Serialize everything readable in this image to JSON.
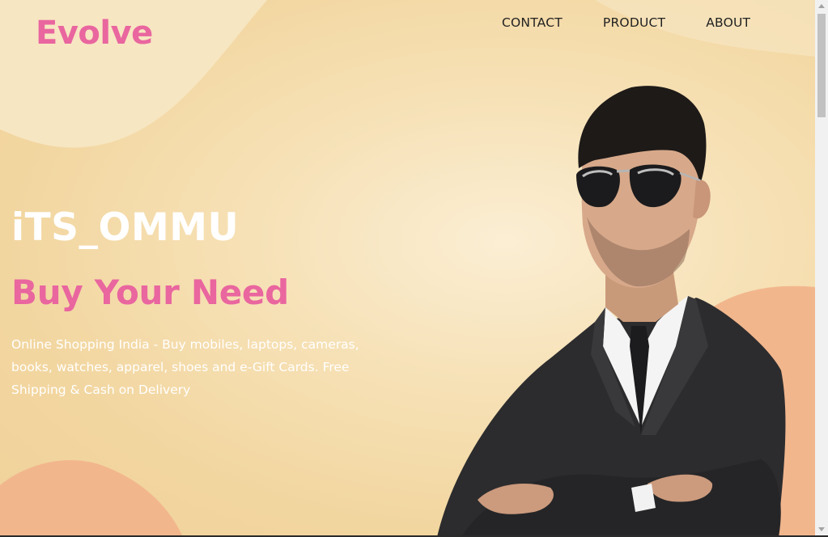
{
  "header": {
    "logo": "Evolve",
    "nav": [
      "CONTACT",
      "PRODUCT",
      "ABOUT"
    ]
  },
  "hero": {
    "brand": "iTS_OMMU",
    "tagline": "Buy Your Need",
    "description": "Online Shopping India - Buy mobiles, laptops, cameras, books, watches, apparel, shoes and e-Gift Cards. Free Shipping & Cash on Delivery"
  },
  "colors": {
    "accent": "#e9669f",
    "background": "#f3d9a8",
    "blob_light": "#f7e6c1",
    "blob_peach": "#f2b68d"
  }
}
